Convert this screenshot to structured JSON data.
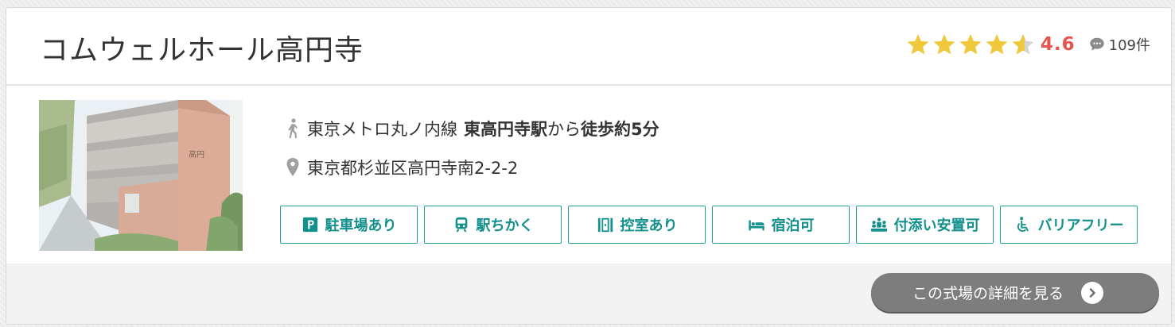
{
  "venue": {
    "name": "コムウェルホール高円寺",
    "rating": "4.6",
    "rating_value": 4.6,
    "review_count": "109件"
  },
  "access": {
    "line": "東京メトロ丸ノ内線",
    "station": "東高円寺駅",
    "from": "から",
    "walk": "徒歩約5分"
  },
  "address": "東京都杉並区高円寺南2-2-2",
  "features": [
    {
      "label": "駐車場あり",
      "icon": "parking-icon"
    },
    {
      "label": "駅ちかく",
      "icon": "train-icon"
    },
    {
      "label": "控室あり",
      "icon": "waiting-room-icon"
    },
    {
      "label": "宿泊可",
      "icon": "bed-icon"
    },
    {
      "label": "付添い安置可",
      "icon": "attendance-icon"
    },
    {
      "label": "バリアフリー",
      "icon": "wheelchair-icon"
    }
  ],
  "detail_button": "この式場の詳細を見る",
  "colors": {
    "accent": "#1f9e9a",
    "rating": "#e6554d",
    "star": "#f0c83c",
    "button": "#7d7d7d"
  }
}
